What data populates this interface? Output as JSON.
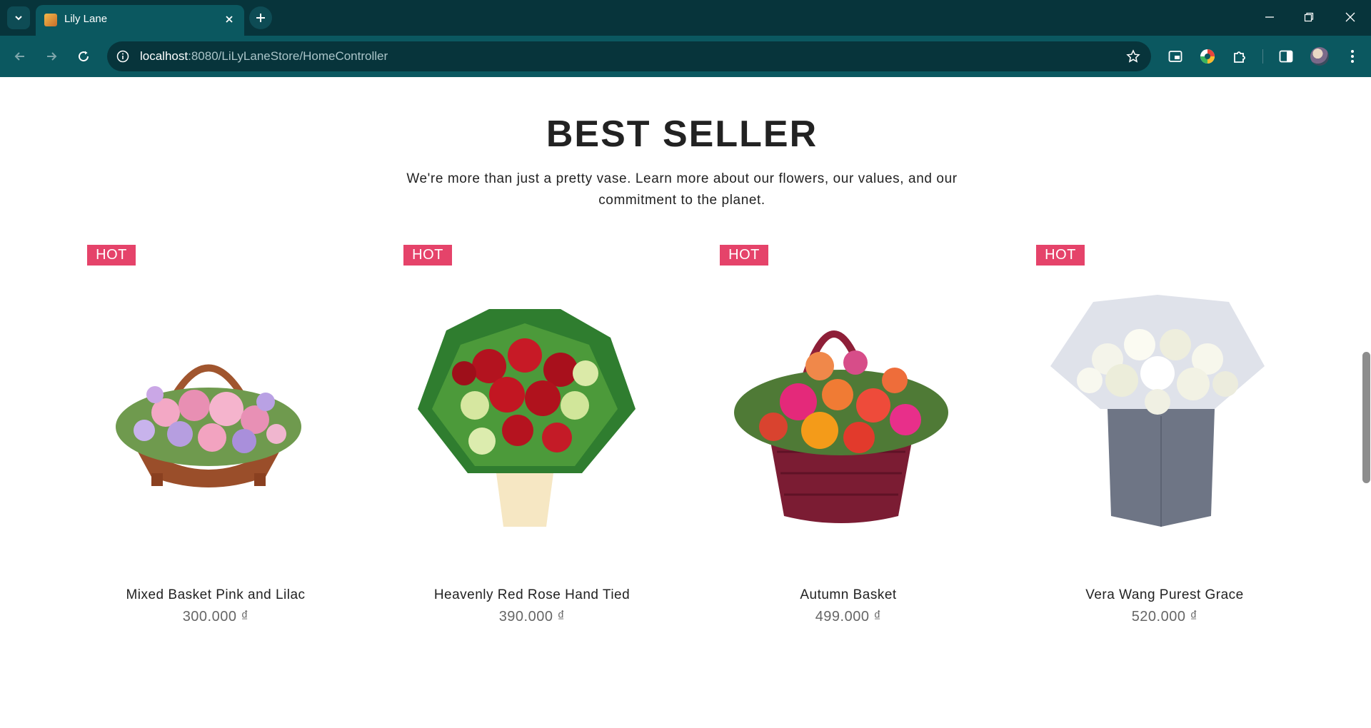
{
  "browser": {
    "tab_title": "Lily Lane",
    "url_host": "localhost",
    "url_rest": ":8080/LiLyLaneStore/HomeController"
  },
  "section": {
    "title": "BEST SELLER",
    "subtitle": "We're more than just a pretty vase. Learn more about our flowers, our values, and our commitment to the planet."
  },
  "products": [
    {
      "badge": "HOT",
      "name": "Mixed Basket Pink and Lilac",
      "price": "300.000 ₫"
    },
    {
      "badge": "HOT",
      "name": "Heavenly Red Rose Hand Tied",
      "price": "390.000 ₫"
    },
    {
      "badge": "HOT",
      "name": "Autumn Basket",
      "price": "499.000 ₫"
    },
    {
      "badge": "HOT",
      "name": "Vera Wang Purest Grace",
      "price": "520.000 ₫"
    }
  ]
}
